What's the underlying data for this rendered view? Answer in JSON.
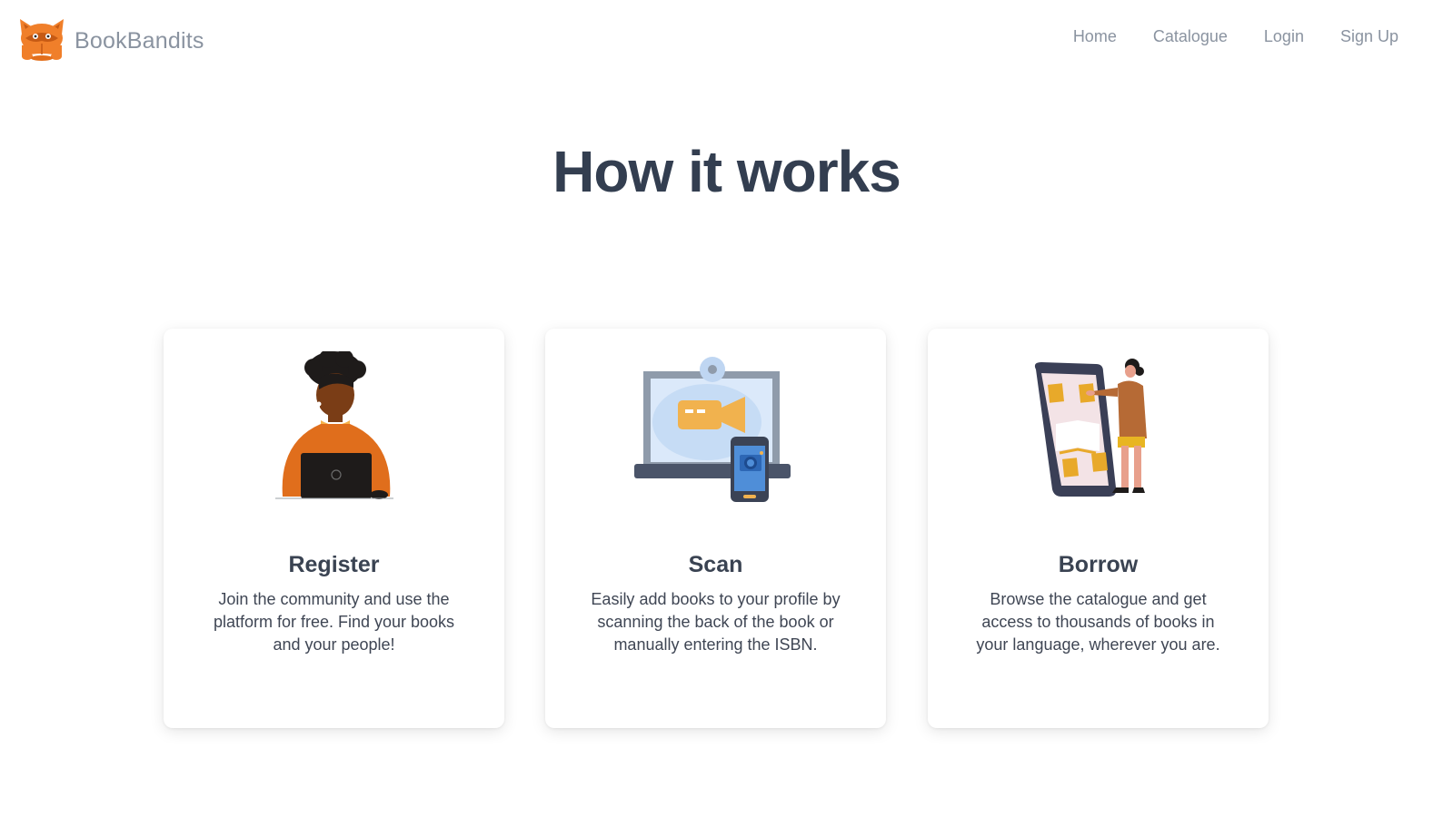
{
  "brand": {
    "name": "BookBandits",
    "logo_icon": "raccoon-reading-logo-icon"
  },
  "nav": {
    "links": [
      "Home",
      "Catalogue",
      "Login",
      "Sign Up"
    ]
  },
  "main": {
    "title": "How it works"
  },
  "steps": [
    {
      "title": "Register",
      "description": "Join the community and use the platform for free. Find your books and your people!",
      "illustration": "person-with-laptop-illustration"
    },
    {
      "title": "Scan",
      "description": "Easily add books to your profile by scanning the back of the book or manually entering the ISBN.",
      "illustration": "laptop-phone-camera-illustration"
    },
    {
      "title": "Borrow",
      "description": "Browse the catalogue and get access to thousands of books in your language, wherever you are.",
      "illustration": "woman-with-tablet-books-illustration"
    }
  ],
  "colors": {
    "accent": "#f07f2a",
    "heading": "#333e50",
    "nav_text": "#8a93a0",
    "text": "#3f4654"
  }
}
